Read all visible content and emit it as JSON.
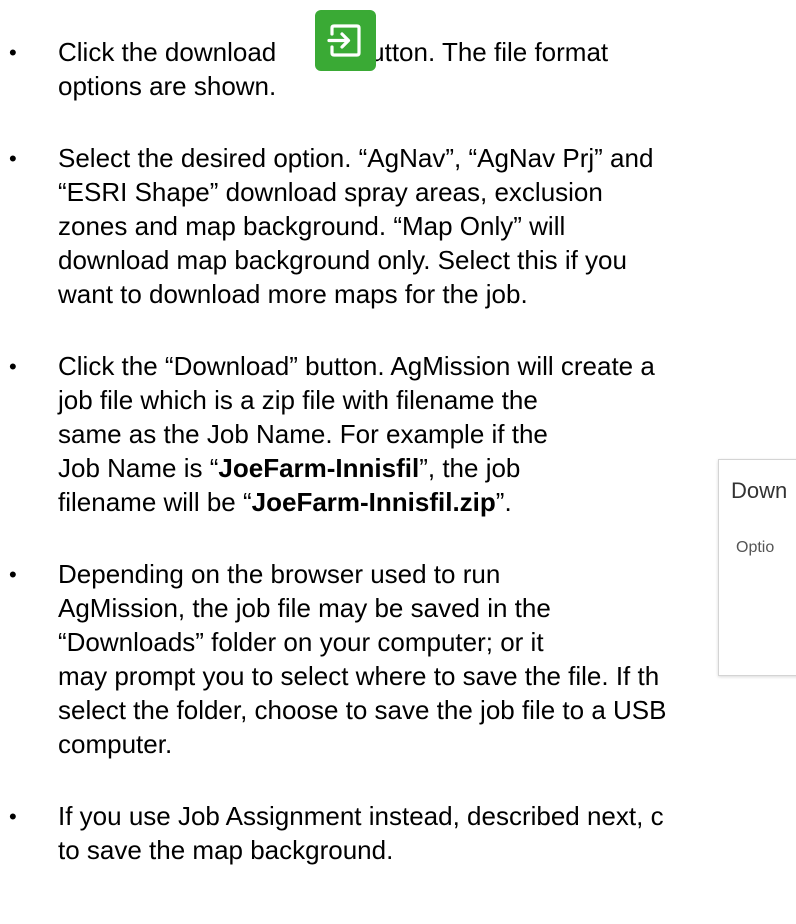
{
  "bullets": [
    {
      "lines": [
        {
          "before": "Click the download ",
          "after": " button. The file format"
        },
        "options are shown."
      ]
    },
    {
      "lines": [
        "Select the desired option. “AgNav”, “AgNav Prj” and",
        "“ESRI Shape” download spray areas, exclusion",
        "zones and map background. “Map Only” will",
        "download map background only. Select this if you",
        "want to download more maps for the job."
      ]
    },
    {
      "lines": [
        "Click the “Download” button. AgMission will create a",
        "job file which is a zip file with filename the",
        "same as the Job Name. For example if the",
        {
          "before": "Job Name is “",
          "bold": "JoeFarm-Innisfil",
          "after": "”, the job"
        },
        {
          "before": "filename will be “",
          "bold": "JoeFarm-Innisfil.zip",
          "after": "”."
        }
      ]
    },
    {
      "lines": [
        "Depending on the browser used to run",
        "AgMission, the job file may be saved in the",
        "“Downloads” folder on your computer; or it",
        "may prompt you to select where to save the file. If th",
        "select the folder, choose to save the job file to a USB",
        "computer."
      ]
    },
    {
      "lines": [
        "If you use Job Assignment instead, described next, c",
        "to save the map background."
      ]
    }
  ],
  "bullet_glyph": "•",
  "download_icon": {
    "name": "download-icon",
    "color": "#3aaa35"
  },
  "dialog": {
    "title": "Down",
    "options_label": "Optio"
  }
}
